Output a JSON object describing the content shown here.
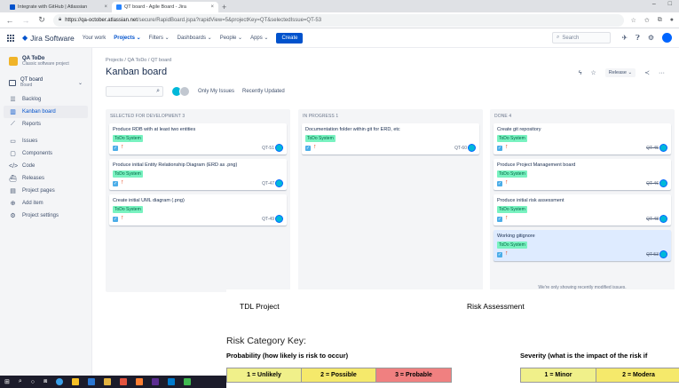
{
  "browser": {
    "tabs": [
      {
        "title": "Integrate with GitHub | Atlassian",
        "favicon_color": "#0052cc",
        "active": false
      },
      {
        "title": "QT board - Agile Board - Jira",
        "favicon_color": "#2684ff",
        "active": true
      }
    ],
    "new_tab": "+",
    "window_controls": [
      "–",
      "□"
    ],
    "url_host": "https://qa-october.atlassian.net",
    "url_path": "/secure/RapidBoard.jspa?rapidView=5&projectKey=QT&selectedIssue=QT-53"
  },
  "jira_nav": {
    "brand": "Jira Software",
    "items": [
      {
        "label": "Your work",
        "active": false
      },
      {
        "label": "Projects ⌄",
        "active": true
      },
      {
        "label": "Filters ⌄",
        "active": false
      },
      {
        "label": "Dashboards ⌄",
        "active": false
      },
      {
        "label": "People ⌄",
        "active": false
      },
      {
        "label": "Apps ⌄",
        "active": false
      }
    ],
    "create_label": "Create",
    "search_placeholder": "Search"
  },
  "sidebar": {
    "project_name": "QA ToDo",
    "project_type": "Classic software project",
    "board_name": "QT board",
    "board_sub": "Board",
    "items_top": [
      {
        "label": "Backlog",
        "icon": "backlog-icon",
        "glyph": "☰",
        "active": false
      },
      {
        "label": "Kanban board",
        "icon": "board-icon",
        "glyph": "▥",
        "active": true
      },
      {
        "label": "Reports",
        "icon": "reports-icon",
        "glyph": "⟋",
        "active": false
      }
    ],
    "items_bottom": [
      {
        "label": "Issues",
        "icon": "issues-icon",
        "glyph": "▭",
        "active": false
      },
      {
        "label": "Components",
        "icon": "components-icon",
        "glyph": "▢",
        "active": false
      },
      {
        "label": "Code",
        "icon": "code-icon",
        "glyph": "</>",
        "active": false
      },
      {
        "label": "Releases",
        "icon": "releases-icon",
        "glyph": "⛴",
        "active": false
      },
      {
        "label": "Project pages",
        "icon": "pages-icon",
        "glyph": "▤",
        "active": false
      },
      {
        "label": "Add item",
        "icon": "add-item-icon",
        "glyph": "⊕",
        "active": false
      },
      {
        "label": "Project settings",
        "icon": "settings-icon",
        "glyph": "⚙",
        "active": false
      }
    ]
  },
  "board": {
    "breadcrumbs": "Projects / QA ToDo / QT board",
    "title": "Kanban board",
    "release_label": "Release ⌄",
    "filters": {
      "only_my_issues": "Only My Issues",
      "recently_updated": "Recently Updated"
    },
    "columns": [
      {
        "header": "SELECTED FOR DEVELOPMENT 3",
        "cards": [
          {
            "summary": "Produce RDB with at least two entities",
            "epic": "ToDo System",
            "key": "QT-51",
            "done": false,
            "highlight": false
          },
          {
            "summary": "Produce initial Entity Relationship Diagram (ERD as .png)",
            "epic": "ToDo System",
            "key": "QT-47",
            "done": false,
            "highlight": false
          },
          {
            "summary": "Create initial UML diagram (.png)",
            "epic": "ToDo System",
            "key": "QT-49",
            "done": false,
            "highlight": false
          }
        ]
      },
      {
        "header": "IN PROGRESS 1",
        "cards": [
          {
            "summary": "Documentation folder within git for ERD, etc",
            "epic": "ToDo System",
            "key": "QT-60",
            "done": false,
            "highlight": false
          }
        ]
      },
      {
        "header": "DONE 4",
        "cards": [
          {
            "summary": "Create git repository",
            "epic": "ToDo System",
            "key": "QT-45",
            "done": true,
            "highlight": false
          },
          {
            "summary": "Produce Project Management board",
            "epic": "ToDo System",
            "key": "QT-46",
            "done": true,
            "highlight": false
          },
          {
            "summary": "Produce initial risk assessment",
            "epic": "ToDo System",
            "key": "QT-48",
            "done": true,
            "highlight": false
          },
          {
            "summary": "Working gitignore",
            "epic": "ToDo System",
            "key": "QT-53",
            "done": true,
            "highlight": true
          }
        ],
        "note": "We're only showing recently modified issues."
      }
    ]
  },
  "document": {
    "header_left": "TDL Project",
    "header_right": "Risk Assessment",
    "key_title": "Risk Category Key:",
    "probability_label": "Probability (how likely is risk to occur)",
    "severity_label": "Severity (what is the impact of the risk if",
    "probability_cells": [
      {
        "label": "1 = Unlikely",
        "color": "#f0f08a"
      },
      {
        "label": "2 = Possible",
        "color": "#f5e96b"
      },
      {
        "label": "3 = Probable",
        "color": "#f08080"
      }
    ],
    "severity_cells": [
      {
        "label": "1 = Minor",
        "color": "#f0f08a"
      },
      {
        "label": "2 = Modera",
        "color": "#f5e96b"
      }
    ]
  },
  "colors": {
    "jira_blue": "#0052cc",
    "epic_green": "#79f2c0",
    "selected_card": "#deebff"
  }
}
